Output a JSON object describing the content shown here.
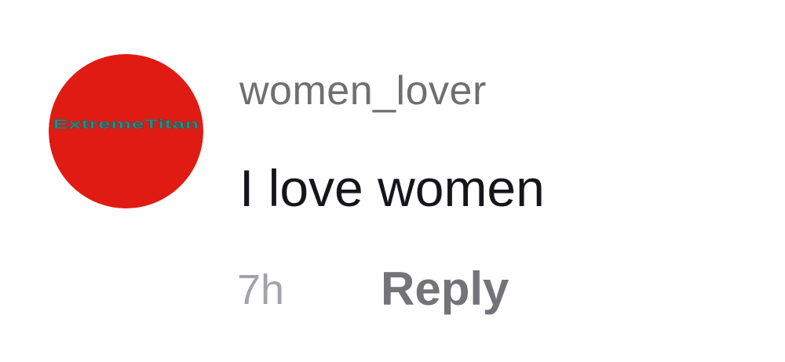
{
  "comment": {
    "avatar": {
      "logo_text": "ExtremeTitan",
      "background_color": "#e01b13",
      "logo_text_color": "#2e8a86"
    },
    "username": "women_lover",
    "text": "I love women",
    "timestamp": "7h",
    "reply_label": "Reply"
  }
}
